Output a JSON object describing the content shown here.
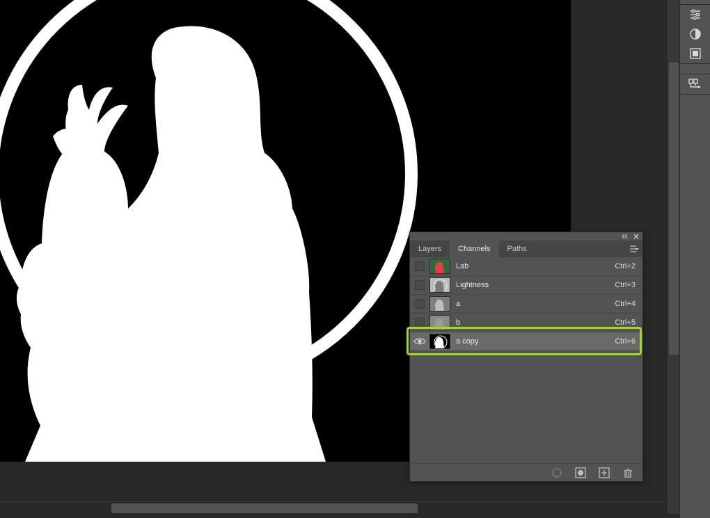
{
  "panel": {
    "tabs": {
      "layers": "Layers",
      "channels": "Channels",
      "paths": "Paths"
    },
    "channels": [
      {
        "name": "Lab",
        "shortcut": "Ctrl+2",
        "visible": false,
        "thumb": "lab"
      },
      {
        "name": "Lightness",
        "shortcut": "Ctrl+3",
        "visible": false,
        "thumb": "light"
      },
      {
        "name": "a",
        "shortcut": "Ctrl+4",
        "visible": false,
        "thumb": "a"
      },
      {
        "name": "b",
        "shortcut": "Ctrl+5",
        "visible": false,
        "thumb": "b"
      },
      {
        "name": "a copy",
        "shortcut": "Ctrl+6",
        "visible": true,
        "thumb": "acopy"
      }
    ],
    "selected_index": 4
  },
  "icons": {
    "adjust": "adjustments-icon",
    "contrast": "contrast-icon",
    "mask": "mask-icon",
    "steps": "steps-icon"
  },
  "colors": {
    "highlight": "#a3d536",
    "panel_bg": "#535353",
    "tab_bg": "#454545",
    "canvas_bg": "#000000",
    "apron_bg": "#282828"
  }
}
